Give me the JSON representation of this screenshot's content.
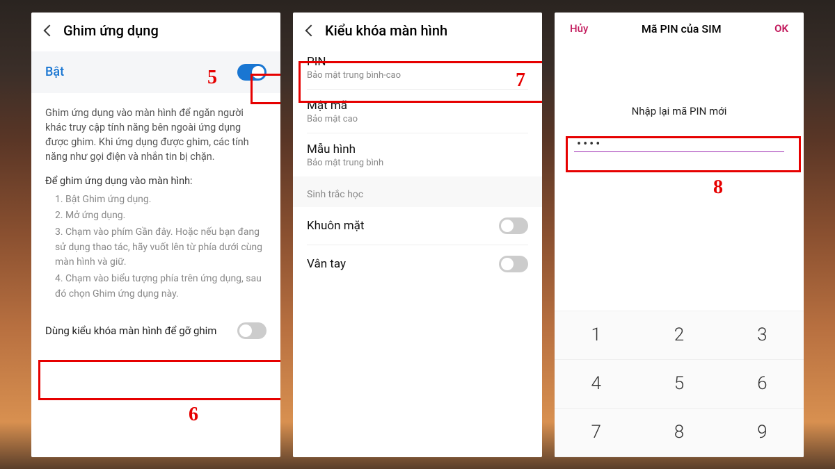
{
  "screen1": {
    "title": "Ghim ứng dụng",
    "on_label": "Bật",
    "description": "Ghim ứng dụng vào màn hình để ngăn người khác truy cập tính năng bên ngoài ứng dụng được ghim. Khi ứng dụng được ghim, các tính năng như gọi điện và nhắn tin bị chặn.",
    "howto_title": "Để ghim ứng dụng vào màn hình:",
    "steps": [
      "1. Bật Ghim ứng dụng.",
      "2. Mở ứng dụng.",
      "3. Chạm vào phím Gần đây. Hoặc nếu bạn đang sử dụng thao tác, hãy vuốt lên từ phía dưới cùng màn hình và giữ.",
      "4. Chạm vào biểu tượng phía trên ứng dụng, sau đó chọn Ghim ứng dụng này."
    ],
    "lock_row": "Dùng kiểu khóa màn hình để gỡ ghim"
  },
  "screen2": {
    "title": "Kiểu khóa màn hình",
    "options": [
      {
        "title": "PIN",
        "sub": "Bảo mật trung bình-cao"
      },
      {
        "title": "Mật mã",
        "sub": "Bảo mật cao"
      },
      {
        "title": "Mẫu hình",
        "sub": "Bảo mật trung bình"
      }
    ],
    "biometric_label": "Sinh trắc học",
    "face": "Khuôn mặt",
    "finger": "Vân tay"
  },
  "screen3": {
    "cancel": "Hủy",
    "title": "Mã PIN của SIM",
    "ok": "OK",
    "prompt": "Nhập lại mã PIN mới",
    "pin_value": "••••",
    "keys": [
      "1",
      "2",
      "3",
      "4",
      "5",
      "6",
      "7",
      "8",
      "9"
    ]
  },
  "callouts": {
    "n5": "5",
    "n6": "6",
    "n7": "7",
    "n8": "8"
  }
}
